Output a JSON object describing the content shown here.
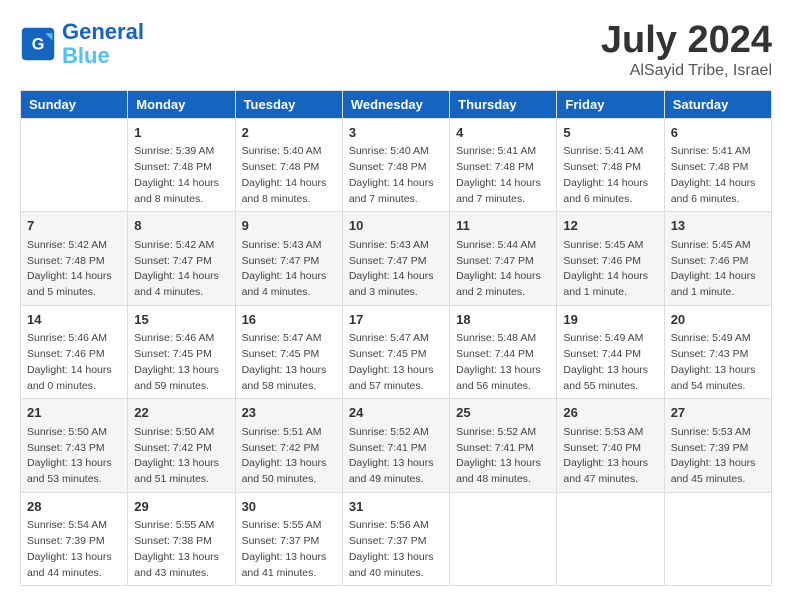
{
  "header": {
    "logo_line1": "General",
    "logo_line2": "Blue",
    "month": "July 2024",
    "location": "AlSayid Tribe, Israel"
  },
  "weekdays": [
    "Sunday",
    "Monday",
    "Tuesday",
    "Wednesday",
    "Thursday",
    "Friday",
    "Saturday"
  ],
  "weeks": [
    [
      {
        "day": "",
        "info": ""
      },
      {
        "day": "1",
        "info": "Sunrise: 5:39 AM\nSunset: 7:48 PM\nDaylight: 14 hours\nand 8 minutes."
      },
      {
        "day": "2",
        "info": "Sunrise: 5:40 AM\nSunset: 7:48 PM\nDaylight: 14 hours\nand 8 minutes."
      },
      {
        "day": "3",
        "info": "Sunrise: 5:40 AM\nSunset: 7:48 PM\nDaylight: 14 hours\nand 7 minutes."
      },
      {
        "day": "4",
        "info": "Sunrise: 5:41 AM\nSunset: 7:48 PM\nDaylight: 14 hours\nand 7 minutes."
      },
      {
        "day": "5",
        "info": "Sunrise: 5:41 AM\nSunset: 7:48 PM\nDaylight: 14 hours\nand 6 minutes."
      },
      {
        "day": "6",
        "info": "Sunrise: 5:41 AM\nSunset: 7:48 PM\nDaylight: 14 hours\nand 6 minutes."
      }
    ],
    [
      {
        "day": "7",
        "info": "Sunrise: 5:42 AM\nSunset: 7:48 PM\nDaylight: 14 hours\nand 5 minutes."
      },
      {
        "day": "8",
        "info": "Sunrise: 5:42 AM\nSunset: 7:47 PM\nDaylight: 14 hours\nand 4 minutes."
      },
      {
        "day": "9",
        "info": "Sunrise: 5:43 AM\nSunset: 7:47 PM\nDaylight: 14 hours\nand 4 minutes."
      },
      {
        "day": "10",
        "info": "Sunrise: 5:43 AM\nSunset: 7:47 PM\nDaylight: 14 hours\nand 3 minutes."
      },
      {
        "day": "11",
        "info": "Sunrise: 5:44 AM\nSunset: 7:47 PM\nDaylight: 14 hours\nand 2 minutes."
      },
      {
        "day": "12",
        "info": "Sunrise: 5:45 AM\nSunset: 7:46 PM\nDaylight: 14 hours\nand 1 minute."
      },
      {
        "day": "13",
        "info": "Sunrise: 5:45 AM\nSunset: 7:46 PM\nDaylight: 14 hours\nand 1 minute."
      }
    ],
    [
      {
        "day": "14",
        "info": "Sunrise: 5:46 AM\nSunset: 7:46 PM\nDaylight: 14 hours\nand 0 minutes."
      },
      {
        "day": "15",
        "info": "Sunrise: 5:46 AM\nSunset: 7:45 PM\nDaylight: 13 hours\nand 59 minutes."
      },
      {
        "day": "16",
        "info": "Sunrise: 5:47 AM\nSunset: 7:45 PM\nDaylight: 13 hours\nand 58 minutes."
      },
      {
        "day": "17",
        "info": "Sunrise: 5:47 AM\nSunset: 7:45 PM\nDaylight: 13 hours\nand 57 minutes."
      },
      {
        "day": "18",
        "info": "Sunrise: 5:48 AM\nSunset: 7:44 PM\nDaylight: 13 hours\nand 56 minutes."
      },
      {
        "day": "19",
        "info": "Sunrise: 5:49 AM\nSunset: 7:44 PM\nDaylight: 13 hours\nand 55 minutes."
      },
      {
        "day": "20",
        "info": "Sunrise: 5:49 AM\nSunset: 7:43 PM\nDaylight: 13 hours\nand 54 minutes."
      }
    ],
    [
      {
        "day": "21",
        "info": "Sunrise: 5:50 AM\nSunset: 7:43 PM\nDaylight: 13 hours\nand 53 minutes."
      },
      {
        "day": "22",
        "info": "Sunrise: 5:50 AM\nSunset: 7:42 PM\nDaylight: 13 hours\nand 51 minutes."
      },
      {
        "day": "23",
        "info": "Sunrise: 5:51 AM\nSunset: 7:42 PM\nDaylight: 13 hours\nand 50 minutes."
      },
      {
        "day": "24",
        "info": "Sunrise: 5:52 AM\nSunset: 7:41 PM\nDaylight: 13 hours\nand 49 minutes."
      },
      {
        "day": "25",
        "info": "Sunrise: 5:52 AM\nSunset: 7:41 PM\nDaylight: 13 hours\nand 48 minutes."
      },
      {
        "day": "26",
        "info": "Sunrise: 5:53 AM\nSunset: 7:40 PM\nDaylight: 13 hours\nand 47 minutes."
      },
      {
        "day": "27",
        "info": "Sunrise: 5:53 AM\nSunset: 7:39 PM\nDaylight: 13 hours\nand 45 minutes."
      }
    ],
    [
      {
        "day": "28",
        "info": "Sunrise: 5:54 AM\nSunset: 7:39 PM\nDaylight: 13 hours\nand 44 minutes."
      },
      {
        "day": "29",
        "info": "Sunrise: 5:55 AM\nSunset: 7:38 PM\nDaylight: 13 hours\nand 43 minutes."
      },
      {
        "day": "30",
        "info": "Sunrise: 5:55 AM\nSunset: 7:37 PM\nDaylight: 13 hours\nand 41 minutes."
      },
      {
        "day": "31",
        "info": "Sunrise: 5:56 AM\nSunset: 7:37 PM\nDaylight: 13 hours\nand 40 minutes."
      },
      {
        "day": "",
        "info": ""
      },
      {
        "day": "",
        "info": ""
      },
      {
        "day": "",
        "info": ""
      }
    ]
  ]
}
